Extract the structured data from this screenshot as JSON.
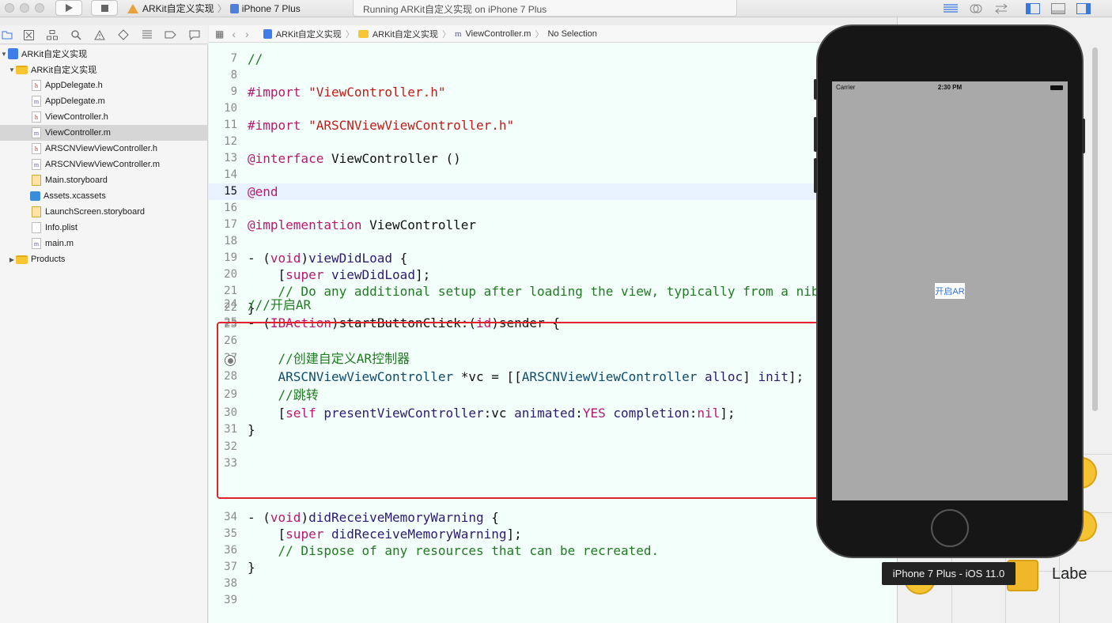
{
  "toolbar": {
    "scheme_project": "ARKit自定义实现",
    "scheme_separator": "〉",
    "scheme_device": "iPhone 7 Plus",
    "activity_status": "Running ARKit自定义实现 on iPhone 7 Plus"
  },
  "navigator": {
    "project": "ARKit自定义实现",
    "group": "ARKit自定义实现",
    "files": [
      {
        "name": "AppDelegate.h",
        "kind": "h"
      },
      {
        "name": "AppDelegate.m",
        "kind": "m"
      },
      {
        "name": "ViewController.h",
        "kind": "h"
      },
      {
        "name": "ViewController.m",
        "kind": "m"
      },
      {
        "name": "ARSCNViewViewController.h",
        "kind": "h"
      },
      {
        "name": "ARSCNViewViewController.m",
        "kind": "m"
      },
      {
        "name": "Main.storyboard",
        "kind": "storyboard"
      },
      {
        "name": "Assets.xcassets",
        "kind": "assets"
      },
      {
        "name": "LaunchScreen.storyboard",
        "kind": "storyboard"
      },
      {
        "name": "Info.plist",
        "kind": "plist"
      },
      {
        "name": "main.m",
        "kind": "m"
      }
    ],
    "products": "Products"
  },
  "jumpbar": {
    "project": "ARKit自定义实现",
    "group": "ARKit自定义实现",
    "file": "ViewController.m",
    "selection": "No Selection"
  },
  "editor": {
    "lines": [
      {
        "n": "7",
        "text": "//"
      },
      {
        "n": "8",
        "text": ""
      },
      {
        "n": "9",
        "text": "#import \"ViewController.h\""
      },
      {
        "n": "10",
        "text": ""
      },
      {
        "n": "11",
        "text": "#import \"ARSCNViewViewController.h\""
      },
      {
        "n": "12",
        "text": ""
      },
      {
        "n": "13",
        "text": "@interface ViewController ()"
      },
      {
        "n": "14",
        "text": ""
      },
      {
        "n": "15",
        "text": "@end"
      },
      {
        "n": "16",
        "text": ""
      },
      {
        "n": "17",
        "text": "@implementation ViewController"
      },
      {
        "n": "18",
        "text": ""
      },
      {
        "n": "19",
        "text": "- (void)viewDidLoad {"
      },
      {
        "n": "20",
        "text": "    [super viewDidLoad];"
      },
      {
        "n": "21",
        "text": "    // Do any additional setup after loading the view, typically from a nib"
      },
      {
        "n": "22",
        "text": "}"
      },
      {
        "n": "23",
        "text": ""
      },
      {
        "n": "24",
        "text": "///开启AR"
      },
      {
        "n": "25",
        "text": "- (IBAction)startButtonClick:(id)sender {"
      },
      {
        "n": "26",
        "text": ""
      },
      {
        "n": "27",
        "text": "    //创建自定义AR控制器"
      },
      {
        "n": "28",
        "text": "    ARSCNViewViewController *vc = [[ARSCNViewViewController alloc] init];"
      },
      {
        "n": "29",
        "text": "    //跳转"
      },
      {
        "n": "30",
        "text": "    [self presentViewController:vc animated:YES completion:nil];"
      },
      {
        "n": "31",
        "text": "}"
      },
      {
        "n": "32",
        "text": ""
      },
      {
        "n": "33",
        "text": ""
      },
      {
        "n": "34",
        "text": "- (void)didReceiveMemoryWarning {"
      },
      {
        "n": "35",
        "text": "    [super didReceiveMemoryWarning];"
      },
      {
        "n": "36",
        "text": "    // Dispose of any resources that can be recreated."
      },
      {
        "n": "37",
        "text": "}"
      },
      {
        "n": "38",
        "text": ""
      },
      {
        "n": "39",
        "text": ""
      }
    ]
  },
  "simulator": {
    "carrier": "Carrier",
    "time": "2:30 PM",
    "button_label": "开启AR",
    "tooltip": "iPhone 7 Plus - iOS 11.0"
  },
  "library": {
    "label_item": "Labe"
  },
  "colors": {
    "highlight_border": "#e0242d",
    "editor_bg": "#f3fffa",
    "keyword": "#b8196e",
    "string": "#c41a16",
    "comment": "#217a21"
  }
}
